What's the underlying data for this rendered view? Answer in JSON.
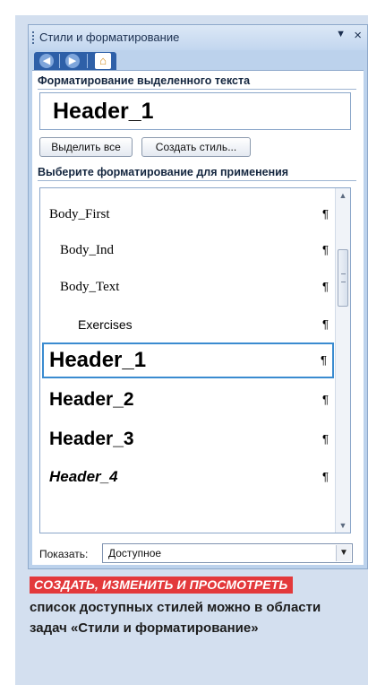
{
  "pane": {
    "title": "Стили и форматирование",
    "menu_glyph": "▼",
    "close_glyph": "×",
    "nav": {
      "back_icon": "◀",
      "forward_icon": "▶",
      "home_icon": "⌂"
    },
    "selected_section": {
      "label": "Форматирование выделенного текста",
      "current_style": "Header_1",
      "select_all_label": "Выделить все",
      "new_style_label": "Создать стиль..."
    },
    "apply_section": {
      "label": "Выберите форматирование для применения",
      "styles": [
        {
          "name": "Body_First",
          "mark": "¶"
        },
        {
          "name": "Body_Ind",
          "mark": "¶"
        },
        {
          "name": "Body_Text",
          "mark": "¶"
        },
        {
          "name": "Exercises",
          "mark": "¶"
        },
        {
          "name": "Header_1",
          "mark": "¶",
          "selected": true
        },
        {
          "name": "Header_2",
          "mark": "¶"
        },
        {
          "name": "Header_3",
          "mark": "¶"
        },
        {
          "name": "Header_4",
          "mark": "¶"
        }
      ]
    },
    "show": {
      "label": "Показать:",
      "value": "Доступное"
    }
  },
  "caption": {
    "highlight": "СОЗДАТЬ, ИЗМЕНИТЬ И ПРОСМОТРЕТЬ",
    "line1": "список доступных стилей можно в области",
    "line2": "задач «Стили и форматирование»"
  },
  "colors": {
    "accent": "#e3393b",
    "pane_bg": "#bcd2ec",
    "selection": "#3a8bd0"
  }
}
